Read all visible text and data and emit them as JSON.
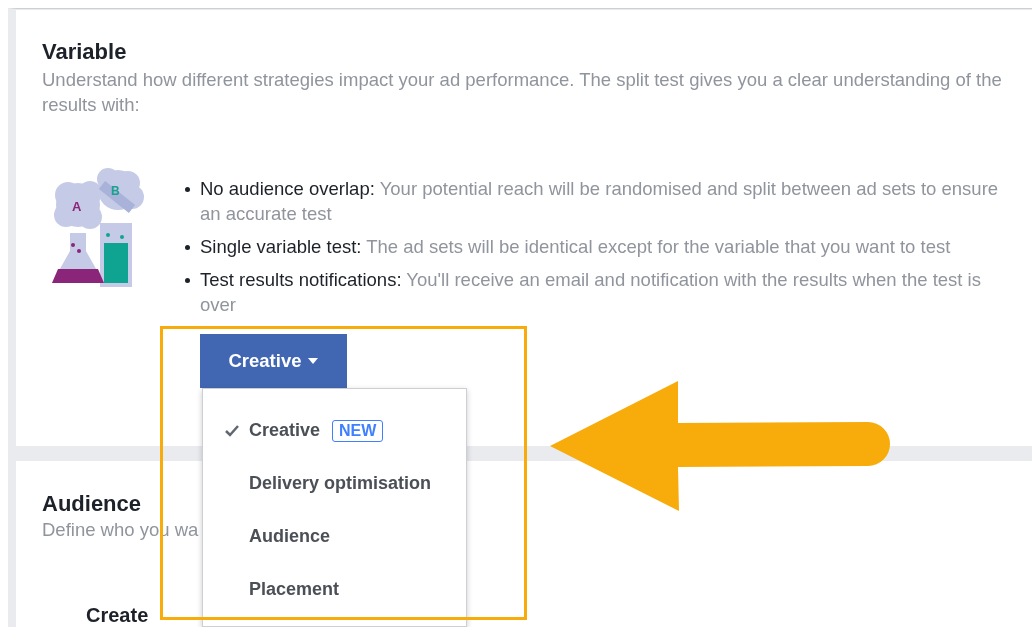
{
  "variable": {
    "title": "Variable",
    "description": "Understand how different strategies impact your ad performance. The split test gives you a clear understanding of the results with:",
    "bullets": [
      {
        "label": "No audience overlap:",
        "text": "Your potential reach will be randomised and split between ad sets to ensure an accurate test"
      },
      {
        "label": "Single variable test:",
        "text": "The ad sets will be identical except for the variable that you want to test"
      },
      {
        "label": "Test results notifications:",
        "text": "You'll receive an email and notification with the results when the test is over"
      }
    ],
    "dropdown": {
      "label": "Creative",
      "expanded": true,
      "options": [
        {
          "label": "Creative",
          "selected": true,
          "badge": "NEW"
        },
        {
          "label": "Delivery optimisation",
          "selected": false
        },
        {
          "label": "Audience",
          "selected": false
        },
        {
          "label": "Placement",
          "selected": false
        }
      ]
    }
  },
  "illustration": {
    "labels": [
      "A",
      "B"
    ]
  },
  "audience": {
    "title": "Audience",
    "description": "Define who you wa",
    "field_label": "Create"
  },
  "annotation": {
    "highlight": true,
    "arrow": true
  }
}
